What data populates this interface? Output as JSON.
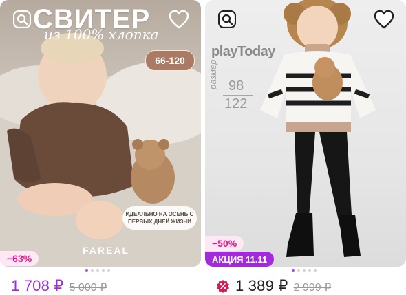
{
  "cards": [
    {
      "brand_banner_title": "СВИТЕР",
      "brand_banner_subtitle": "из 100% хлопка",
      "size_badge": "66-120",
      "autumn_badge": "ИДЕАЛЬНО НА ОСЕНЬ С ПЕРВЫХ ДНЕЙ ЖИЗНИ",
      "brand_name": "FAREAL",
      "discount": "−63%",
      "price": "1 708 ₽",
      "old_price": "5 000 ₽",
      "dots_total": 5,
      "dots_active": 0
    },
    {
      "brand_logo": "playToday",
      "size_label": "размер",
      "size_top": "98",
      "size_bottom": "122",
      "discount": "−50%",
      "promo_label": "АКЦИЯ 11.11",
      "price": "1 389 ₽",
      "old_price": "2 999 ₽",
      "dots_total": 5,
      "dots_active": 0
    }
  ],
  "icons": {
    "similar_search": "similar-search-icon",
    "favorite": "heart-icon",
    "promo": "percent-badge-icon"
  },
  "colors": {
    "accent": "#a22bd9",
    "discount_text": "#e2188c",
    "discount_bg": "#fde8f4",
    "old_price": "#9a9a9a"
  }
}
